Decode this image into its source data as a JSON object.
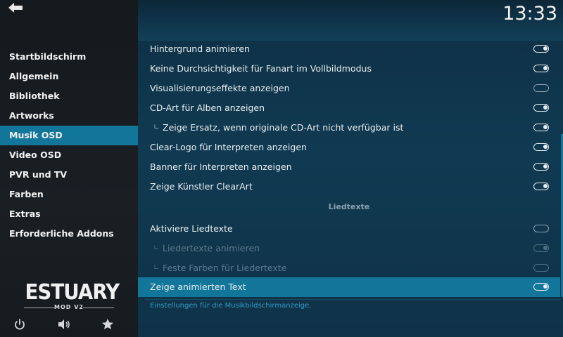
{
  "clock": "13:33",
  "sidebar": {
    "items": [
      {
        "label": "Startbildschirm",
        "active": false
      },
      {
        "label": "Allgemein",
        "active": false
      },
      {
        "label": "Bibliothek",
        "active": false
      },
      {
        "label": "Artworks",
        "active": false
      },
      {
        "label": "Musik OSD",
        "active": true
      },
      {
        "label": "Video OSD",
        "active": false
      },
      {
        "label": "PVR und TV",
        "active": false
      },
      {
        "label": "Farben",
        "active": false
      },
      {
        "label": "Extras",
        "active": false
      },
      {
        "label": "Erforderliche Addons",
        "active": false
      }
    ],
    "logo_title": "ESTUARY",
    "logo_subtitle": "MOD V2",
    "footer_icons": [
      "power-icon",
      "volume-icon",
      "star-icon"
    ]
  },
  "settings": {
    "rows": [
      {
        "label": "Hintergrund animieren",
        "state": "on",
        "sub": false,
        "disabled": false
      },
      {
        "label": "Keine Durchsichtigkeit für Fanart im Vollbildmodus",
        "state": "on",
        "sub": false,
        "disabled": false
      },
      {
        "label": "Visualisierungseffekte anzeigen",
        "state": "off",
        "sub": false,
        "disabled": false
      },
      {
        "label": "CD-Art für Alben anzeigen",
        "state": "on",
        "sub": false,
        "disabled": false
      },
      {
        "label": "Zeige Ersatz, wenn originale CD-Art nicht verfügbar ist",
        "state": "on",
        "sub": true,
        "disabled": false
      },
      {
        "label": "Clear-Logo für Interpreten anzeigen",
        "state": "on",
        "sub": false,
        "disabled": false
      },
      {
        "label": "Banner für Interpreten anzeigen",
        "state": "on",
        "sub": false,
        "disabled": false
      },
      {
        "label": "Zeige Künstler ClearArt",
        "state": "on",
        "sub": false,
        "disabled": false
      }
    ],
    "section_title": "Liedtexte",
    "rows2": [
      {
        "label": "Aktiviere Liedtexte",
        "state": "off",
        "sub": false,
        "disabled": false
      },
      {
        "label": "Liedertexte animieren",
        "state": "on",
        "sub": true,
        "disabled": true
      },
      {
        "label": "Feste Farben für Liedertexte",
        "state": "off",
        "sub": true,
        "disabled": true
      },
      {
        "label": "Zeige animierten Text",
        "state": "on",
        "sub": false,
        "disabled": false,
        "focused": true
      }
    ],
    "sub_prefix": "∟",
    "hint": "Einstellungen für die Musikbildschirmanzeige."
  },
  "colors": {
    "accent": "#12769a",
    "hint": "#2f9cc9"
  }
}
